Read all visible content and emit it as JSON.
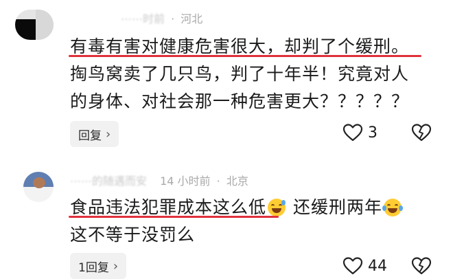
{
  "comments": [
    {
      "user_masked": "⋯⋯时前",
      "location": "河北",
      "lines": [
        "有毒有害对健康危害很大，却判了个缓刑。",
        "掏鸟窝卖了几只鸟，判了十年半！究竟对人",
        "的身体、对社会那一种危害更大？？？？？"
      ],
      "reply_label": "回复",
      "like_count": "3"
    },
    {
      "user_masked": "⋯⋯的随遇而安",
      "time": "14 小时前",
      "location": "北京",
      "line1_text": "食品违法犯罪成本这么低",
      "line1_tail": "还缓刑两年",
      "line2": "这不等于没罚么",
      "reply_label": "1回复",
      "like_count": "44"
    }
  ],
  "icons": {
    "chevron": "chevron-right-icon",
    "like": "heart-outline-icon",
    "dislike": "broken-heart-icon",
    "emoji1": "sweat-grin-emoji",
    "emoji2": "crying-laughing-emoji"
  },
  "colors": {
    "underline": "#e0313b",
    "meta": "#a9a9a9"
  }
}
